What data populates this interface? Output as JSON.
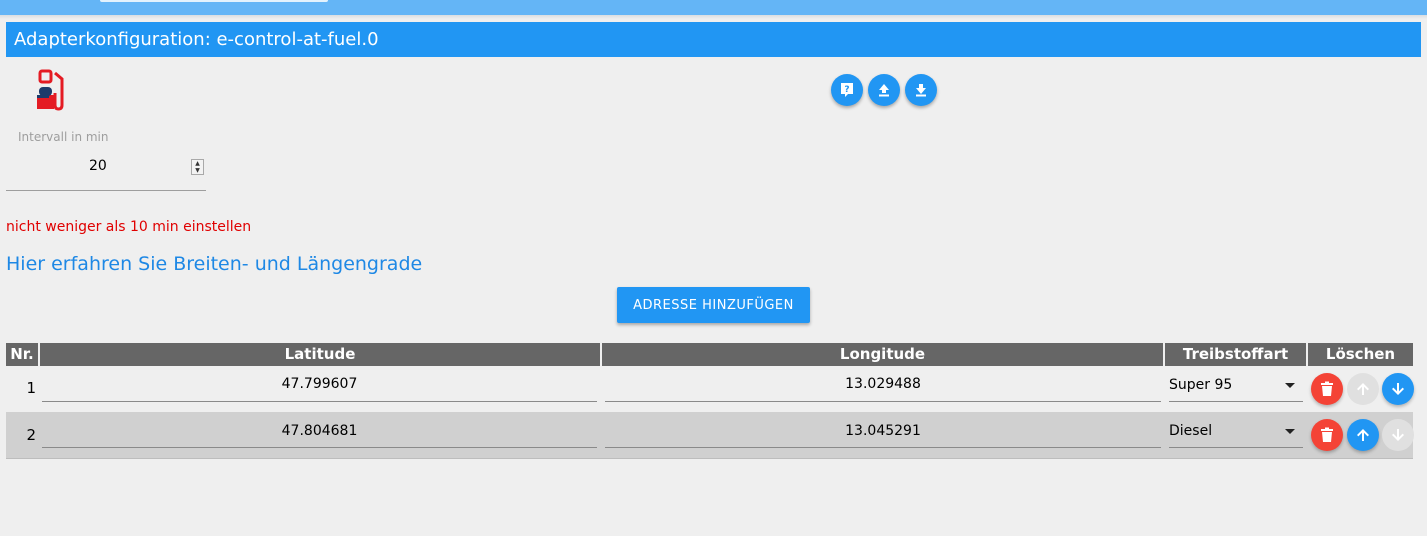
{
  "window": {
    "title": "Adapterkonfiguration: e-control-at-fuel.0"
  },
  "toolbar": {
    "icons": [
      "help-icon",
      "upload-icon",
      "download-icon"
    ]
  },
  "interval": {
    "label": "Intervall in min",
    "value": "20"
  },
  "warning": "nicht weniger als 10 min einstellen",
  "help_link": "Hier erfahren Sie Breiten- und Längengrade",
  "add_button": "ADRESSE HINZUFÜGEN",
  "table": {
    "headers": {
      "nr": "Nr.",
      "latitude": "Latitude",
      "longitude": "Longitude",
      "fuel": "Treibstoffart",
      "delete": "Löschen"
    },
    "rows": [
      {
        "nr": "1",
        "latitude": "47.799607",
        "longitude": "13.029488",
        "fuel": "Super 95",
        "up_enabled": false,
        "down_enabled": true
      },
      {
        "nr": "2",
        "latitude": "47.804681",
        "longitude": "13.045291",
        "fuel": "Diesel",
        "up_enabled": true,
        "down_enabled": false
      }
    ]
  },
  "colors": {
    "accent": "#2196f3",
    "danger": "#f44336",
    "warning_text": "#e00000",
    "header_bg": "#666666"
  }
}
